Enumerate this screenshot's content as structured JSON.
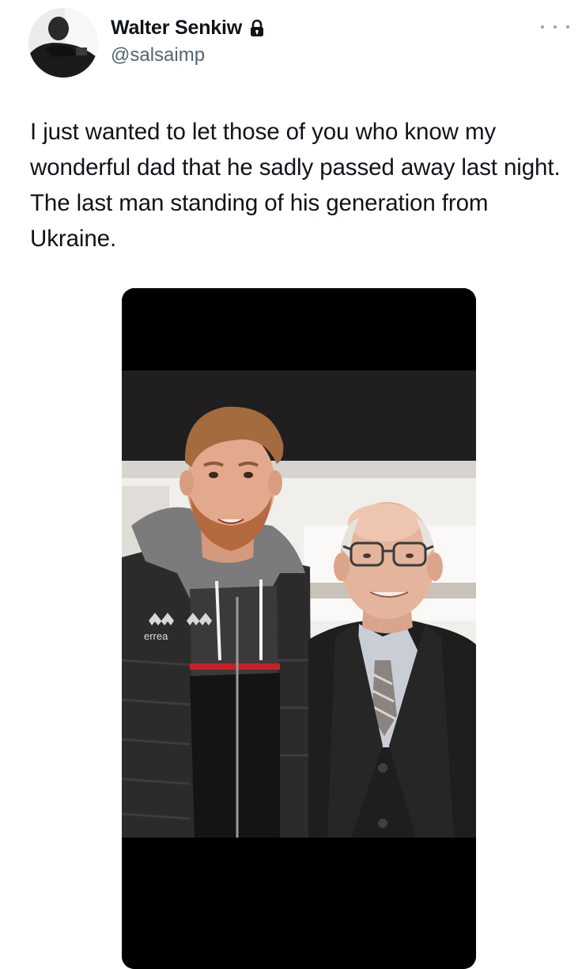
{
  "tweet": {
    "author": {
      "display_name": "Walter Senkiw",
      "handle": "@salsaimp",
      "verified_icon": "lock-icon",
      "avatar_icon": "profile-photo"
    },
    "more_icon": "more-horizontal-icon",
    "text": "I just wanted to let those of you who know my wonderful dad that he sadly passed away last night. The last man standing of his generation from Ukraine.",
    "media": {
      "kind": "photo",
      "shirt_logo_text": "errea"
    }
  },
  "colors": {
    "text_primary": "#0f1419",
    "text_secondary": "#536471",
    "background": "#ffffff",
    "media_letterbox": "#000000"
  }
}
